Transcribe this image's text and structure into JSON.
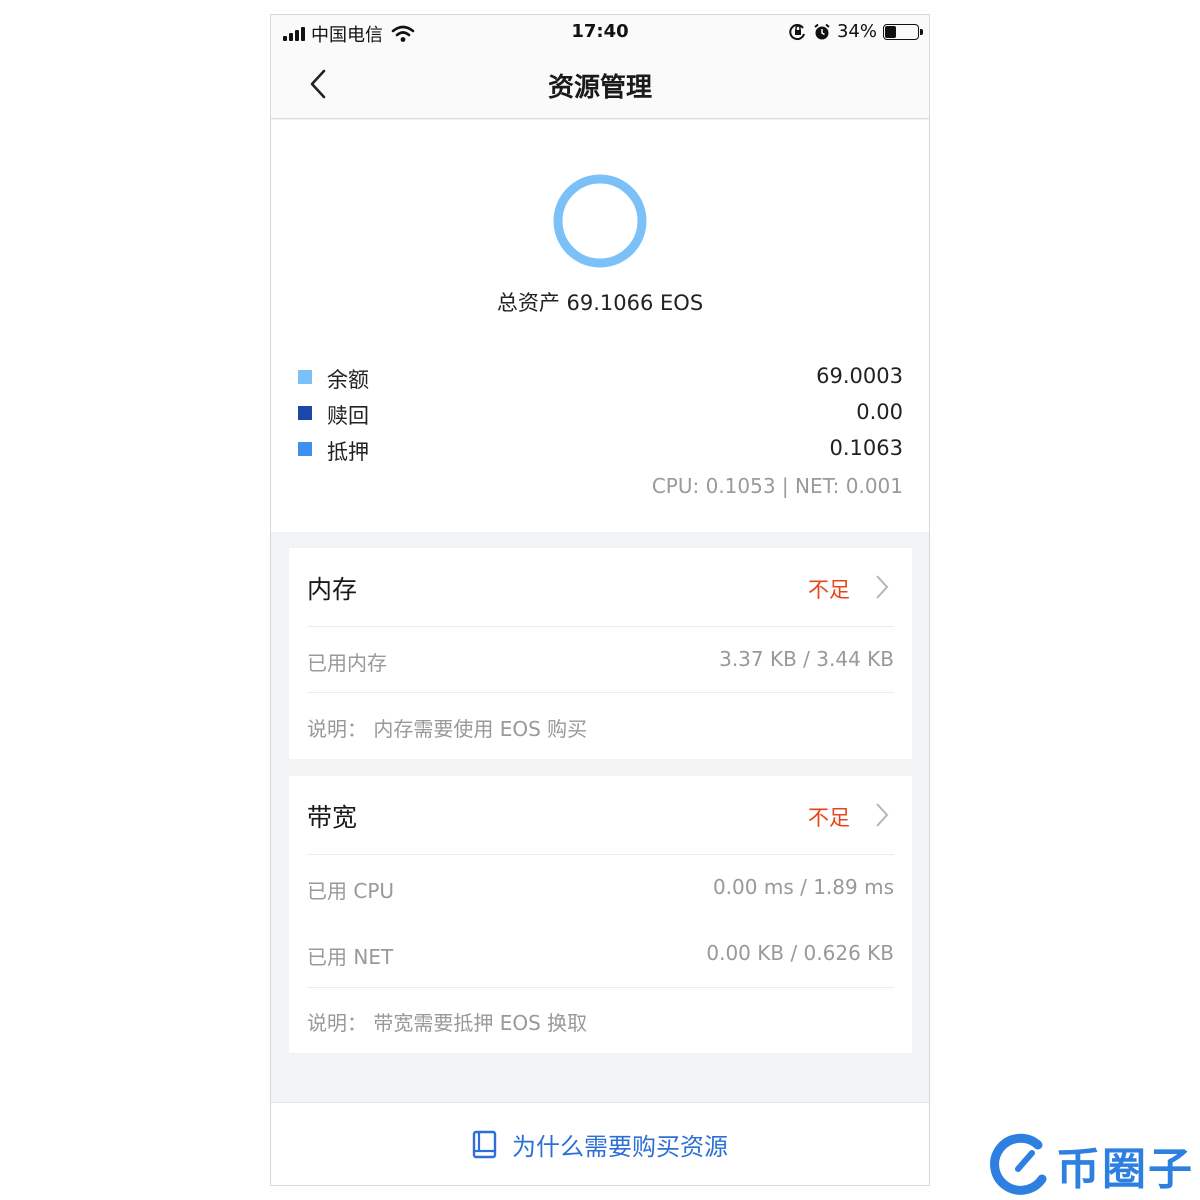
{
  "status_bar": {
    "carrier": "中国电信",
    "time": "17:40",
    "battery": "34%",
    "battery_level": 0.34
  },
  "nav": {
    "title": "资源管理"
  },
  "summary": {
    "total_label": "总资产 69.1066 EOS",
    "legend": [
      {
        "label": "余额",
        "value": "69.0003",
        "color": "#7cc0f8"
      },
      {
        "label": "赎回",
        "value": "0.00",
        "color": "#1948a8"
      },
      {
        "label": "抵押",
        "value": "0.1063",
        "color": "#3d8ff0"
      }
    ],
    "stake_detail": "CPU: 0.1053 | NET: 0.001",
    "donut_color": "#7cc0f8"
  },
  "memory_card": {
    "title": "内存",
    "status": "不足",
    "rows": [
      {
        "key": "已用内存",
        "value": "3.37 KB / 3.44 KB"
      }
    ],
    "note": "说明： 内存需要使用 EOS 购买"
  },
  "bandwidth_card": {
    "title": "带宽",
    "status": "不足",
    "rows": [
      {
        "key": "已用 CPU",
        "value": "0.00 ms / 1.89 ms"
      },
      {
        "key": "已用 NET",
        "value": "0.00 KB / 0.626 KB"
      }
    ],
    "note": "说明： 带宽需要抵押 EOS 换取"
  },
  "bottom_link": {
    "label": "为什么需要购买资源",
    "icon": "book-icon"
  },
  "watermark": {
    "text": "币圈子"
  },
  "colors": {
    "accent": "#2d6fd6",
    "warning": "#e8451b"
  }
}
